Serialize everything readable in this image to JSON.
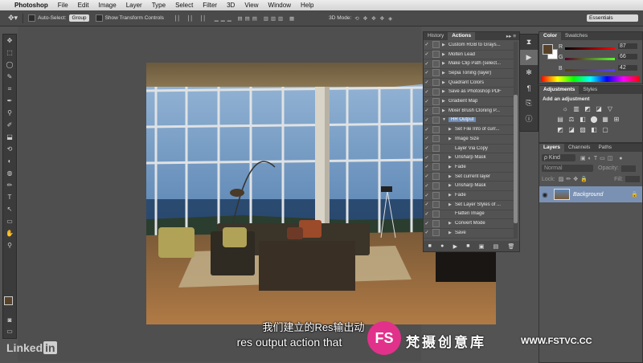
{
  "menubar": {
    "apple": "",
    "app": "Photoshop",
    "items": [
      "File",
      "Edit",
      "Image",
      "Layer",
      "Type",
      "Select",
      "Filter",
      "3D",
      "View",
      "Window",
      "Help"
    ]
  },
  "options": {
    "auto_select": "Auto-Select:",
    "group": "Group",
    "transform": "Show Transform Controls",
    "mode3d": "3D Mode:",
    "workspace": "Essentials"
  },
  "tools": [
    "✥",
    "⬚",
    "◯",
    "✎",
    "⌗",
    "✒",
    "⚲",
    "✐",
    "⬓",
    "⟲",
    "◐",
    "◍",
    "✏",
    "T",
    "↖",
    "▭",
    "✋",
    "⚲"
  ],
  "actions_panel": {
    "tabs": [
      "History",
      "Actions"
    ],
    "rows": [
      {
        "label": "Custom RGB to Grays...",
        "tri": "▶"
      },
      {
        "label": "Molten Lead",
        "tri": "▶"
      },
      {
        "label": "Make Clip Path (select...",
        "tri": "▶"
      },
      {
        "label": "Sepia Toning (layer)",
        "tri": "▶"
      },
      {
        "label": "Quadrant Colors",
        "tri": "▶"
      },
      {
        "label": "Save as Photoshop PDF",
        "tri": "▶"
      },
      {
        "label": "Gradient Map",
        "tri": "▶"
      },
      {
        "label": "Mixer Brush Cloning P...",
        "tri": "▶"
      },
      {
        "label": "HR Output",
        "tri": "▼",
        "selected": true
      },
      {
        "label": "Set File Info of curr...",
        "tri": "▶",
        "indent": true
      },
      {
        "label": "Image Size",
        "tri": "▶",
        "indent": true
      },
      {
        "label": "Layer Via Copy",
        "tri": "",
        "indent": true
      },
      {
        "label": "Unsharp Mask",
        "tri": "▶",
        "indent": true
      },
      {
        "label": "Fade",
        "tri": "▶",
        "indent": true
      },
      {
        "label": "Set current layer",
        "tri": "▶",
        "indent": true
      },
      {
        "label": "Unsharp Mask",
        "tri": "▶",
        "indent": true
      },
      {
        "label": "Fade",
        "tri": "▶",
        "indent": true
      },
      {
        "label": "Set Layer Styles of ...",
        "tri": "▶",
        "indent": true
      },
      {
        "label": "Flatten Image",
        "tri": "",
        "indent": true
      },
      {
        "label": "Convert Mode",
        "tri": "▶",
        "indent": true
      },
      {
        "label": "Save",
        "tri": "▶",
        "indent": true
      }
    ],
    "footer_icons": [
      "■",
      "●",
      "▶",
      "■",
      "▣",
      "▤",
      "🗑"
    ]
  },
  "color_panel": {
    "tabs": [
      "Color",
      "Swatches"
    ],
    "r_label": "R",
    "g_label": "G",
    "b_label": "B",
    "r": "87",
    "g": "66",
    "b": "42",
    "foreground": "#574229"
  },
  "adjustments_panel": {
    "tabs": [
      "Adjustments",
      "Styles"
    ],
    "heading": "Add an adjustment",
    "icons_row1": [
      "☼",
      "▥",
      "◩",
      "◪",
      "▽"
    ],
    "icons_row2": [
      "▤",
      "⚖",
      "◧",
      "⬤",
      "▦",
      "⊞"
    ],
    "icons_row3": [
      "◩",
      "◪",
      "▨",
      "◧",
      "▢"
    ]
  },
  "layers_panel": {
    "tabs": [
      "Layers",
      "Channels",
      "Paths"
    ],
    "kind": "ρ Kind",
    "blend": "Normal",
    "opacity_label": "Opacity:",
    "fill_label": "Fill:",
    "lock_label": "Lock:",
    "layer_name": "Background"
  },
  "subtitle": {
    "zh": "我们建立的Res输出动",
    "en": "res output action that"
  },
  "watermark": {
    "fs": "FS",
    "brand": "梵摄创意库",
    "url": "WWW.FSTVC.CC"
  },
  "linkedin": {
    "text": "Linked",
    "in": "in"
  }
}
